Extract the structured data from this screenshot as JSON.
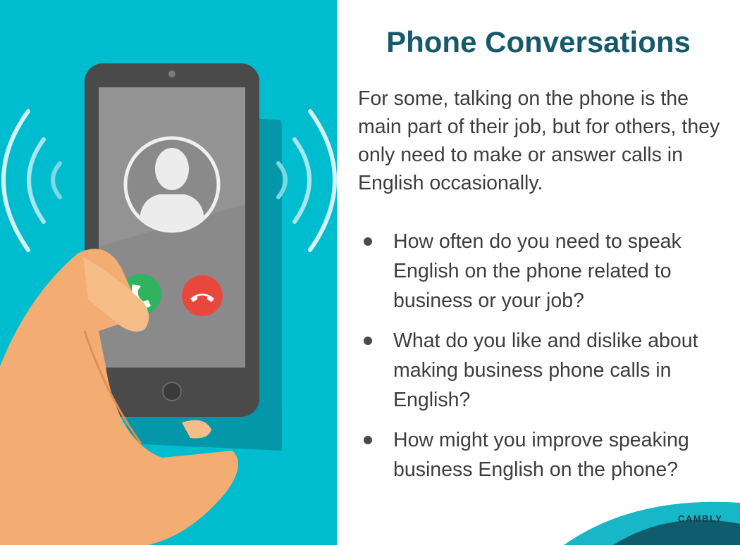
{
  "slide": {
    "title": "Phone Conversations",
    "intro": "For some, talking on the phone is the main part of their job, but for others, they only need to make or answer calls in English occasionally.",
    "questions": [
      "How often do you need to speak English on the phone related to business or your job?",
      "What do you like and dislike about making business phone calls in English?",
      "How might you improve speaking business English on the phone?"
    ],
    "brand": "CAMBLY"
  },
  "illustration": {
    "icons": [
      "phone-icon",
      "contact-avatar-icon",
      "accept-call-icon",
      "decline-call-icon",
      "signal-waves-icon"
    ],
    "colors": {
      "background": "#00bccf",
      "phone_body": "#4a4a4a",
      "screen": "#8a8a8a",
      "accept": "#2fb35f",
      "decline": "#e8473d",
      "skin": "#f3ad72"
    }
  },
  "colors": {
    "title": "#16596b",
    "body_text": "#3d3d3d",
    "brand": "#1a3b47",
    "deco_light": "#18b7c7",
    "deco_dark": "#0f5c6e"
  }
}
